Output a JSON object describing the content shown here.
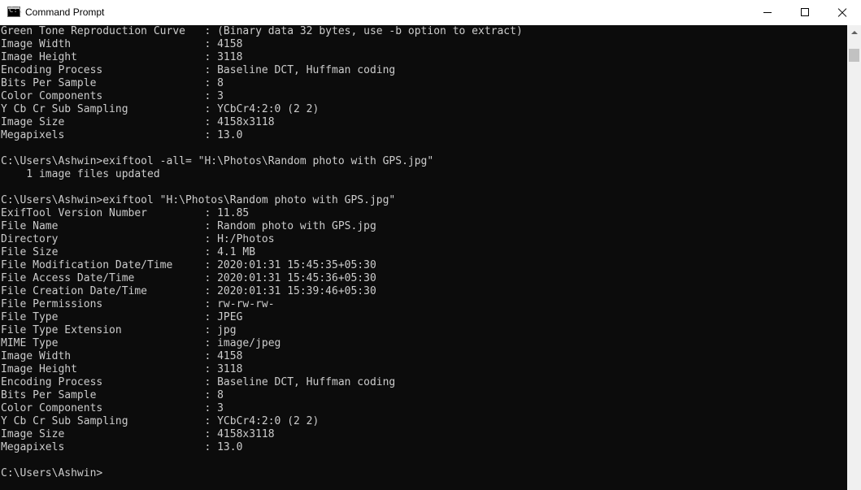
{
  "window": {
    "title": "Command Prompt",
    "app_icon_glyph": "C:\\",
    "icon": "command-prompt-icon"
  },
  "titlebar_buttons": {
    "minimize": "minimize-icon",
    "maximize": "maximize-icon",
    "close": "close-icon"
  },
  "colors": {
    "console_background": "#0c0c0c",
    "console_text": "#cccccc",
    "titlebar_background": "#ffffff",
    "scrollbar_track": "#f0f0f0",
    "scrollbar_thumb": "#c2c2c2"
  },
  "console": {
    "lines": [
      "Green Tone Reproduction Curve   : (Binary data 32 bytes, use -b option to extract)",
      "Image Width                     : 4158",
      "Image Height                    : 3118",
      "Encoding Process                : Baseline DCT, Huffman coding",
      "Bits Per Sample                 : 8",
      "Color Components                : 3",
      "Y Cb Cr Sub Sampling            : YCbCr4:2:0 (2 2)",
      "Image Size                      : 4158x3118",
      "Megapixels                      : 13.0",
      "",
      "C:\\Users\\Ashwin>exiftool -all= \"H:\\Photos\\Random photo with GPS.jpg\"",
      "    1 image files updated",
      "",
      "C:\\Users\\Ashwin>exiftool \"H:\\Photos\\Random photo with GPS.jpg\"",
      "ExifTool Version Number         : 11.85",
      "File Name                       : Random photo with GPS.jpg",
      "Directory                       : H:/Photos",
      "File Size                       : 4.1 MB",
      "File Modification Date/Time     : 2020:01:31 15:45:35+05:30",
      "File Access Date/Time           : 2020:01:31 15:45:36+05:30",
      "File Creation Date/Time         : 2020:01:31 15:39:46+05:30",
      "File Permissions                : rw-rw-rw-",
      "File Type                       : JPEG",
      "File Type Extension             : jpg",
      "MIME Type                       : image/jpeg",
      "Image Width                     : 4158",
      "Image Height                    : 3118",
      "Encoding Process                : Baseline DCT, Huffman coding",
      "Bits Per Sample                 : 8",
      "Color Components                : 3",
      "Y Cb Cr Sub Sampling            : YCbCr4:2:0 (2 2)",
      "Image Size                      : 4158x3118",
      "Megapixels                      : 13.0",
      "",
      "C:\\Users\\Ashwin>"
    ]
  }
}
